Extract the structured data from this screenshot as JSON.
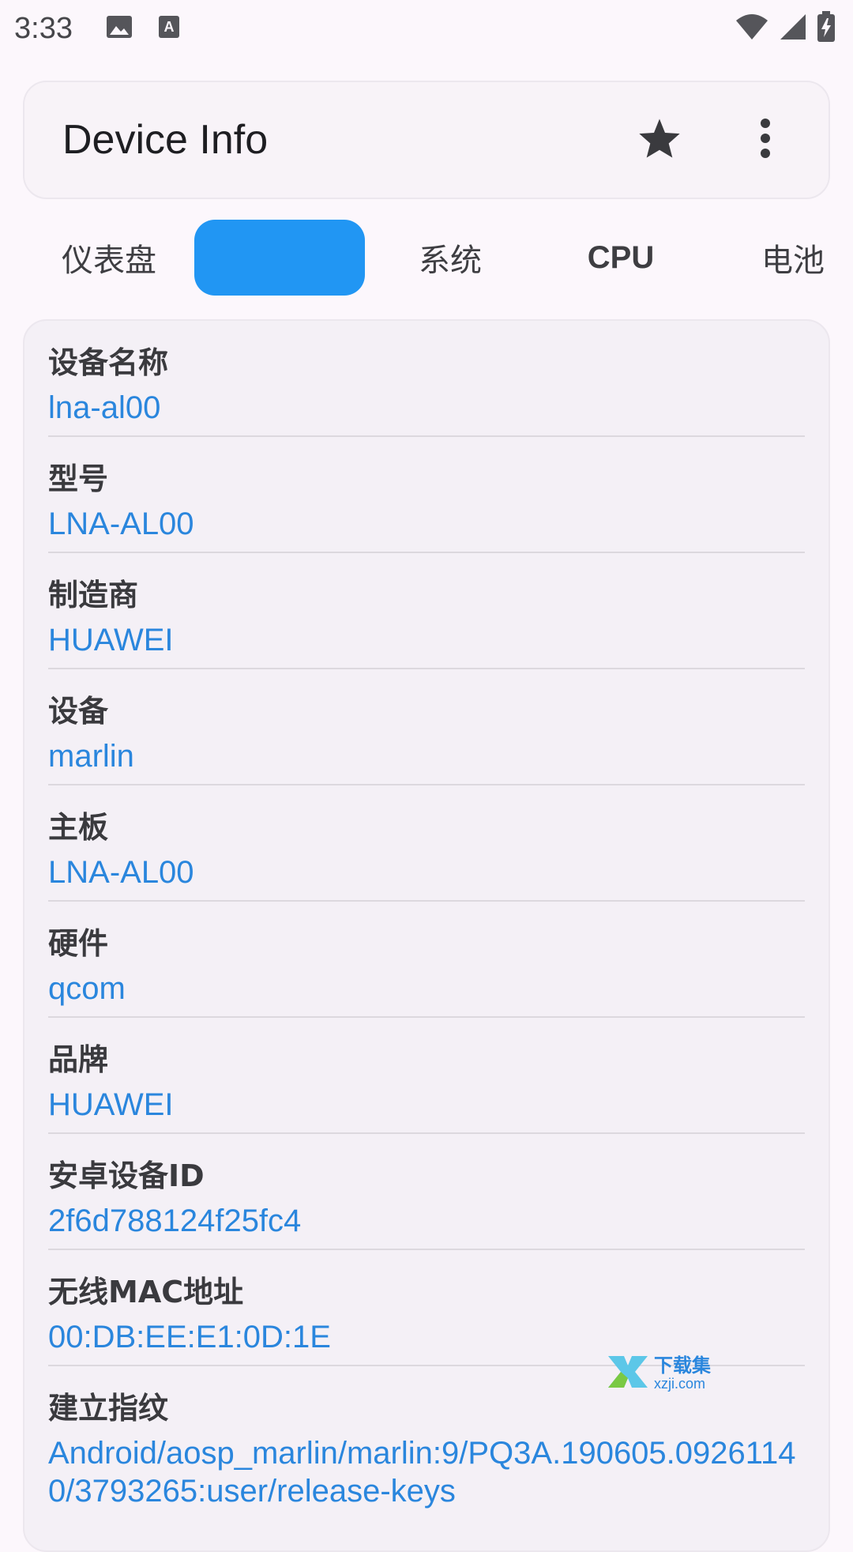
{
  "status_bar": {
    "time": "3:33",
    "icons": [
      "image-icon",
      "font-icon",
      "wifi-icon",
      "signal-icon",
      "battery-charging-icon"
    ]
  },
  "app_bar": {
    "title": "Device Info",
    "actions": [
      "star-icon",
      "more-vert-icon"
    ]
  },
  "tabs": [
    {
      "label": "仪表盘",
      "active": false
    },
    {
      "label": "",
      "active": true
    },
    {
      "label": "系统",
      "active": false
    },
    {
      "label": "CPU",
      "active": false
    },
    {
      "label": "电池",
      "active": false
    }
  ],
  "device_info": [
    {
      "label": "设备名称",
      "value": "lna-al00"
    },
    {
      "label": "型号",
      "value": "LNA-AL00"
    },
    {
      "label": "制造商",
      "value": "HUAWEI"
    },
    {
      "label": "设备",
      "value": "marlin"
    },
    {
      "label": "主板",
      "value": "LNA-AL00"
    },
    {
      "label": "硬件",
      "value": "qcom"
    },
    {
      "label": "品牌",
      "value": "HUAWEI"
    },
    {
      "label": "安卓设备ID",
      "value": "2f6d788124f25fc4"
    },
    {
      "label": "无线MAC地址",
      "value": "00:DB:EE:E1:0D:1E"
    },
    {
      "label": "建立指纹",
      "value": "Android/aosp_marlin/marlin:9/PQ3A.190605.09261140/3793265:user/release-keys"
    }
  ],
  "watermark": {
    "line1": "下载集",
    "line2": "xzji.com"
  },
  "colors": {
    "accent": "#2196f3",
    "value_text": "#2a86dd",
    "background": "#fcf7fc"
  }
}
